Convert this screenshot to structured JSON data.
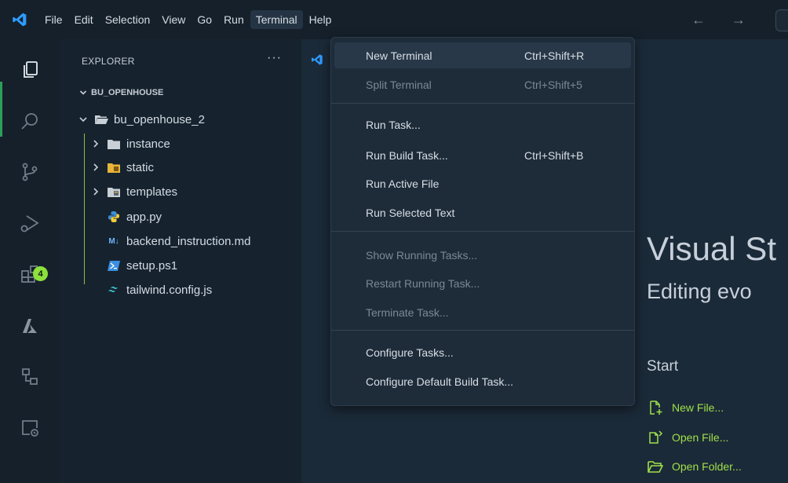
{
  "menubar": {
    "items": [
      "File",
      "Edit",
      "Selection",
      "View",
      "Go",
      "Run",
      "Terminal",
      "Help"
    ],
    "nav_arrows": "← →"
  },
  "activitybar": {
    "icons": [
      "explorer-icon",
      "search-icon",
      "source-control-icon",
      "run-debug-icon",
      "extensions-icon",
      "azure-icon",
      "remote-explorer-icon",
      "remote-icon"
    ],
    "extensions_badge": "4"
  },
  "sidebar": {
    "title": "EXPLORER",
    "more": "···",
    "root_folder": "BU_OPENHOUSE",
    "tree": [
      {
        "label": "bu_openhouse_2",
        "type": "folder-open",
        "depth": 1
      },
      {
        "label": "instance",
        "type": "folder",
        "depth": 2
      },
      {
        "label": "static",
        "type": "folder-static",
        "depth": 2
      },
      {
        "label": "templates",
        "type": "folder-templates",
        "depth": 2
      },
      {
        "label": "app.py",
        "type": "python",
        "depth": 2
      },
      {
        "label": "backend_instruction.md",
        "type": "markdown",
        "depth": 2
      },
      {
        "label": "setup.ps1",
        "type": "powershell",
        "depth": 2
      },
      {
        "label": "tailwind.config.js",
        "type": "tailwind",
        "depth": 2
      }
    ]
  },
  "terminal_menu": {
    "items": [
      {
        "label": "New Terminal",
        "shortcut": "Ctrl+Shift+R",
        "disabled": false
      },
      {
        "label": "Split Terminal",
        "shortcut": "Ctrl+Shift+5",
        "disabled": true
      },
      {
        "label": "Run Task...",
        "shortcut": "",
        "disabled": false
      },
      {
        "label": "Run Build Task...",
        "shortcut": "Ctrl+Shift+B",
        "disabled": false
      },
      {
        "label": "Run Active File",
        "shortcut": "",
        "disabled": false
      },
      {
        "label": "Run Selected Text",
        "shortcut": "",
        "disabled": false
      },
      {
        "label": "Show Running Tasks...",
        "shortcut": "",
        "disabled": true
      },
      {
        "label": "Restart Running Task...",
        "shortcut": "",
        "disabled": true
      },
      {
        "label": "Terminate Task...",
        "shortcut": "",
        "disabled": true
      },
      {
        "label": "Configure Tasks...",
        "shortcut": "",
        "disabled": false
      },
      {
        "label": "Configure Default Build Task...",
        "shortcut": "",
        "disabled": false
      }
    ]
  },
  "welcome": {
    "title": "Visual St",
    "subtitle": "Editing evo",
    "start_heading": "Start",
    "links": [
      "New File...",
      "Open File...",
      "Open Folder..."
    ]
  },
  "colors": {
    "accent_green": "#9fe04a",
    "badge": "#8ce23a",
    "background": "#1b2a38"
  }
}
